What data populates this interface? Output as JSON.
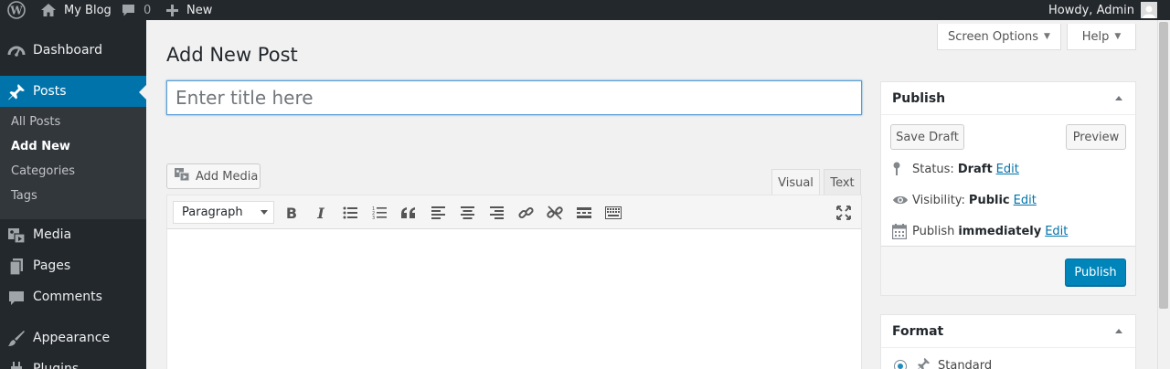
{
  "adminbar": {
    "site_name": "My Blog",
    "comments_count": "0",
    "new_label": "New",
    "howdy": "Howdy, Admin"
  },
  "sidebar": {
    "items": [
      {
        "label": "Dashboard",
        "icon": "dashboard-icon"
      },
      {
        "label": "Posts",
        "icon": "pushpin-icon"
      },
      {
        "label": "Media",
        "icon": "media-icon"
      },
      {
        "label": "Pages",
        "icon": "pages-icon"
      },
      {
        "label": "Comments",
        "icon": "comment-icon"
      },
      {
        "label": "Appearance",
        "icon": "paintbrush-icon"
      },
      {
        "label": "Plugins",
        "icon": "plugin-icon"
      }
    ],
    "submenu": [
      "All Posts",
      "Add New",
      "Categories",
      "Tags"
    ]
  },
  "header": {
    "screen_options": "Screen Options",
    "help": "Help",
    "page_title": "Add New Post"
  },
  "editor": {
    "title_placeholder": "Enter title here",
    "add_media": "Add Media",
    "tab_visual": "Visual",
    "tab_text": "Text",
    "format_value": "Paragraph"
  },
  "publish_box": {
    "title": "Publish",
    "save_draft": "Save Draft",
    "preview": "Preview",
    "status_label": "Status:",
    "status_value": "Draft",
    "visibility_label": "Visibility:",
    "visibility_value": "Public",
    "publish_label": "Publish",
    "publish_value": "immediately",
    "edit": "Edit",
    "publish_button": "Publish"
  },
  "format_box": {
    "title": "Format",
    "standard": "Standard"
  },
  "colors": {
    "adminbar_bg": "#23282d",
    "active_menu": "#0073aa",
    "primary_button": "#0085ba"
  }
}
